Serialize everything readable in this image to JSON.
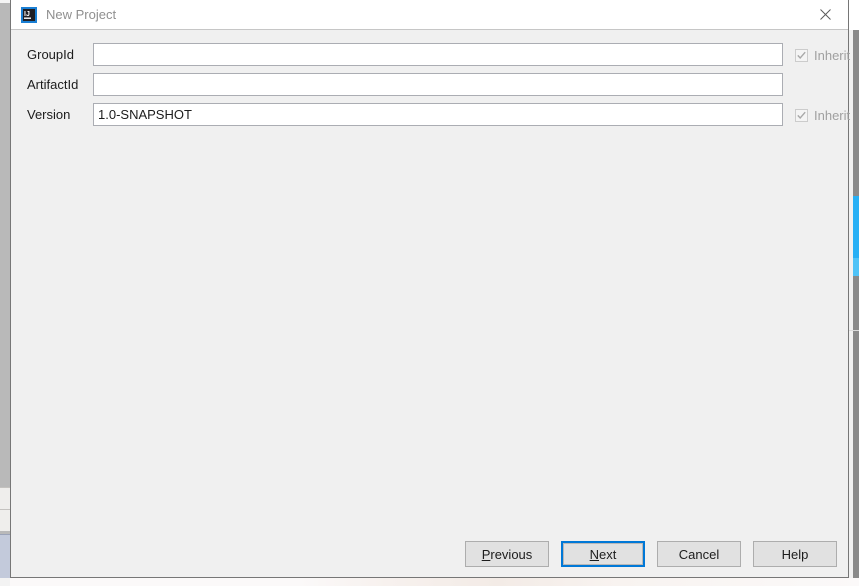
{
  "window": {
    "title": "New Project",
    "app_icon": "intellij-idea-icon",
    "close_icon": "close-icon"
  },
  "form": {
    "rows": [
      {
        "label": "GroupId",
        "value": "",
        "placeholder": "",
        "inherit": {
          "label": "Inherit",
          "checked": true,
          "enabled": false
        }
      },
      {
        "label": "ArtifactId",
        "value": "",
        "placeholder": "",
        "inherit": null
      },
      {
        "label": "Version",
        "value": "1.0-SNAPSHOT",
        "placeholder": "",
        "inherit": {
          "label": "Inherit",
          "checked": true,
          "enabled": false
        }
      }
    ]
  },
  "buttons": {
    "previous": {
      "label": "Previous",
      "mnemonic": "P",
      "default": false
    },
    "next": {
      "label": "Next",
      "mnemonic": "N",
      "default": true
    },
    "cancel": {
      "label": "Cancel",
      "mnemonic": "",
      "default": false
    },
    "help": {
      "label": "Help",
      "mnemonic": "",
      "default": false
    }
  },
  "colors": {
    "accent": "#0078d7",
    "dialog_background": "#f0f0f0",
    "titlebar_background": "#ffffff",
    "title_text": "#8f8f8f",
    "scrollbar_thumb": "#27b0f5",
    "icon_border": "#1a7fd4"
  }
}
